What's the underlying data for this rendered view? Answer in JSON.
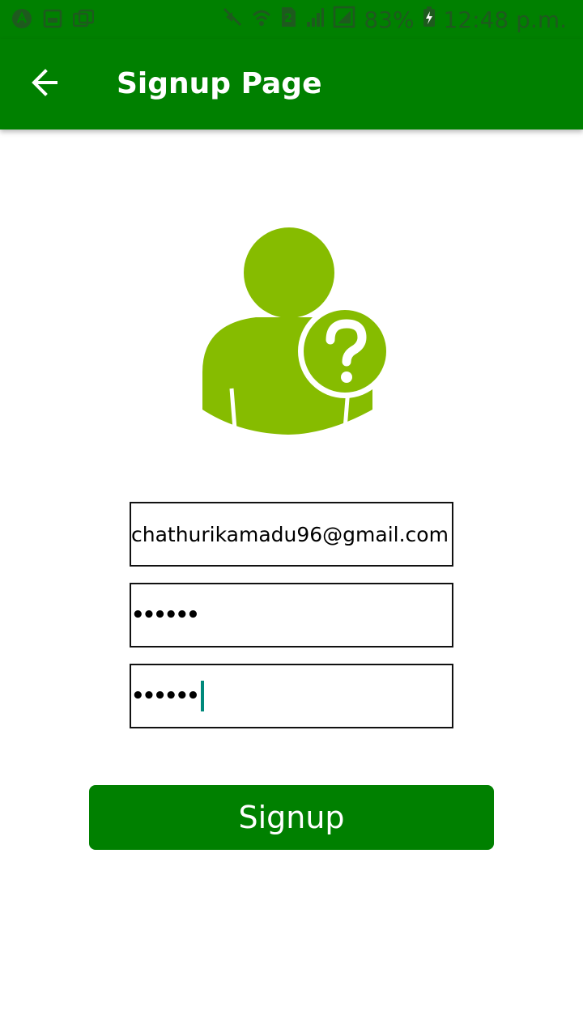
{
  "status_bar": {
    "left_icons": [
      "app-notification-icon",
      "image-notification-icon",
      "multi-window-icon"
    ],
    "right_icons": [
      "mute-icon",
      "wifi-icon",
      "sim-icon",
      "signal-icon",
      "nosim-signal-icon",
      "battery-charging-icon"
    ],
    "battery_percent": "83%",
    "time": "12:48 p.m."
  },
  "app_bar": {
    "back_icon": "arrow-back-icon",
    "title": "Signup Page"
  },
  "avatar": {
    "icon": "user-question-icon",
    "color": "#86bc00"
  },
  "form": {
    "email_value": "chathurikamadu96@gmail.com",
    "password_value": "••••••",
    "confirm_password_value": "••••••"
  },
  "signup_button": {
    "label": "Signup"
  },
  "colors": {
    "primary": "#008000",
    "avatar": "#86bc00",
    "caret": "#00897b"
  }
}
